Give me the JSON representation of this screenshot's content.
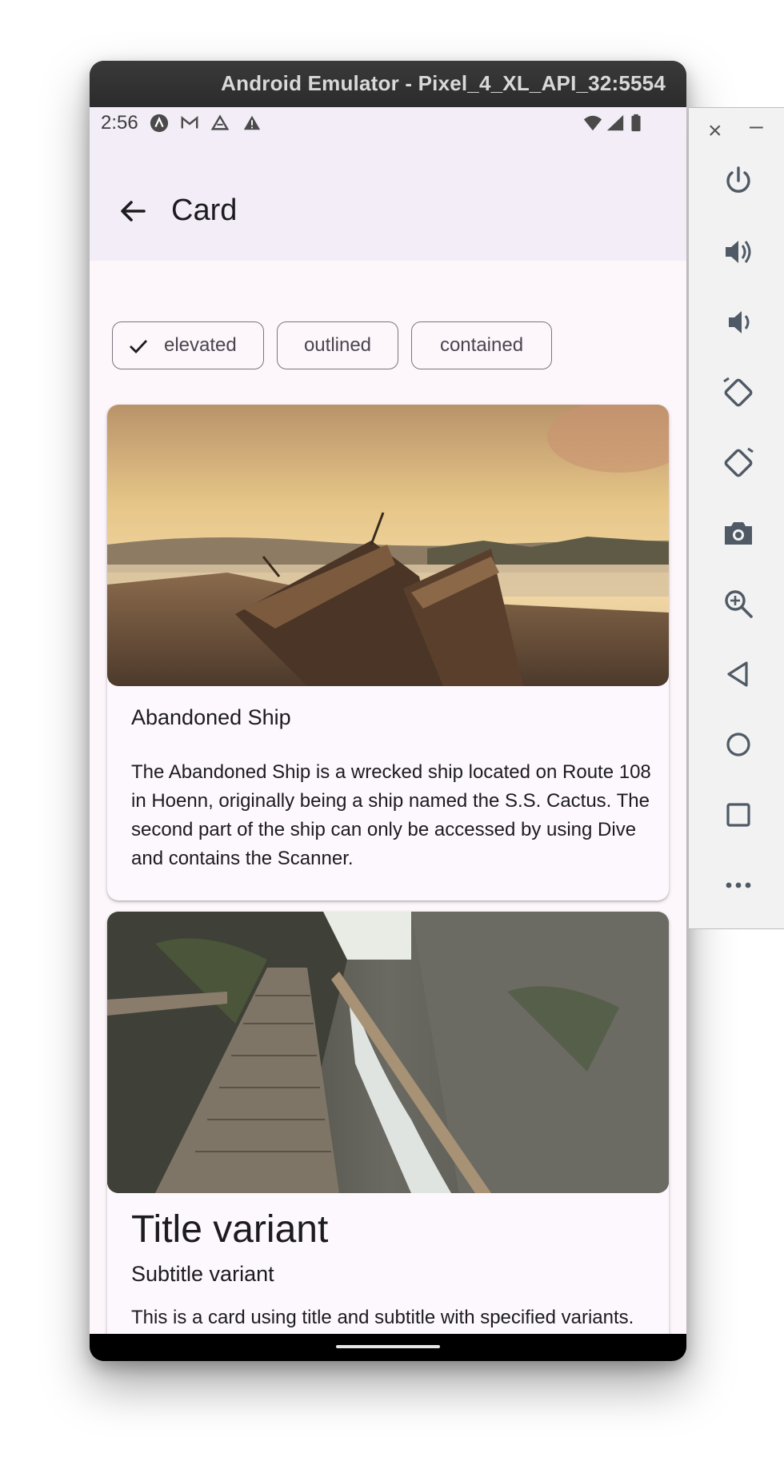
{
  "window": {
    "title": "Android Emulator - Pixel_4_XL_API_32:5554"
  },
  "status_bar": {
    "time": "2:56",
    "left_icons": [
      "app-notification-icon",
      "gmail-icon",
      "drive-icon",
      "alert-icon"
    ],
    "right_icons": [
      "wifi-icon",
      "cell-signal-icon",
      "battery-icon"
    ]
  },
  "app_bar": {
    "title": "Card",
    "back_icon": "arrow-left-icon"
  },
  "chips": [
    {
      "label": "elevated",
      "selected": true
    },
    {
      "label": "outlined",
      "selected": false
    },
    {
      "label": "contained",
      "selected": false
    }
  ],
  "cards": [
    {
      "title": "Abandoned Ship",
      "body": "The Abandoned Ship is a wrecked ship located on Route 108 in Hoenn, originally being a ship named the S.S. Cactus. The second part of the ship can only be accessed by using Dive and contains the Scanner."
    },
    {
      "title": "Title variant",
      "subtitle": "Subtitle variant",
      "body": "This is a card using title and subtitle with specified variants."
    }
  ],
  "side_toolbar": {
    "close_glyph": "×",
    "minimize_glyph": "–",
    "tools": [
      "power-icon",
      "volume-up-icon",
      "volume-down-icon",
      "rotate-left-icon",
      "rotate-right-icon",
      "camera-icon",
      "zoom-icon",
      "back-icon",
      "home-icon",
      "overview-icon",
      "more-icon"
    ]
  },
  "colors": {
    "surface": "#fdf7fb",
    "app_bar": "#f2edf6",
    "outline": "#7a757f",
    "on_surface": "#1c1b1f"
  }
}
